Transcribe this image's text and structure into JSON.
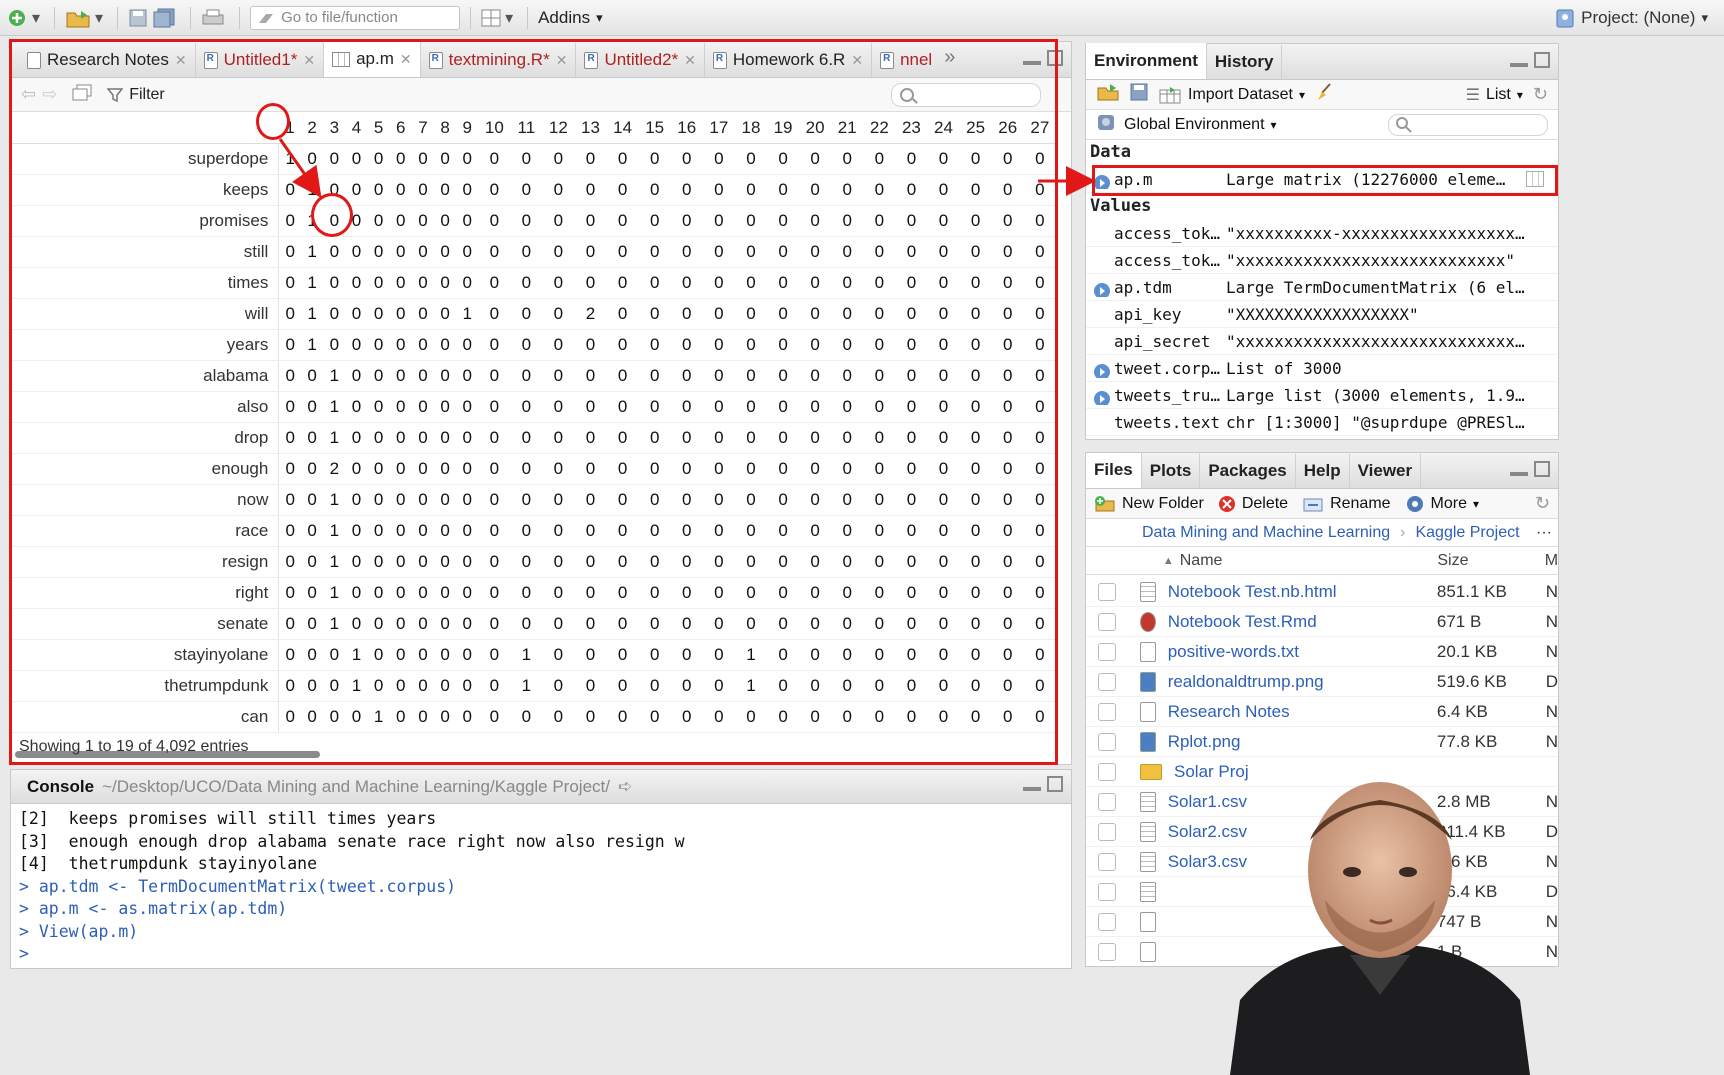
{
  "toolbar": {
    "goto_placeholder": "Go to file/function",
    "addins_label": "Addins",
    "project_label": "Project: (None)"
  },
  "source_tabs": [
    {
      "label": "Research Notes",
      "modified": false
    },
    {
      "label": "Untitled1*",
      "modified": true
    },
    {
      "label": "ap.m",
      "modified": false,
      "active": true
    },
    {
      "label": "textmining.R*",
      "modified": true
    },
    {
      "label": "Untitled2*",
      "modified": true
    },
    {
      "label": "Homework 6.R",
      "modified": false
    },
    {
      "label": "nnel",
      "modified": true
    }
  ],
  "viewer": {
    "filter_label": "Filter",
    "status": "Showing 1 to 19 of 4,092 entries",
    "columns": [
      "1",
      "2",
      "3",
      "4",
      "5",
      "6",
      "7",
      "8",
      "9",
      "10",
      "11",
      "12",
      "13",
      "14",
      "15",
      "16",
      "17",
      "18",
      "19",
      "20",
      "21",
      "22",
      "23",
      "24",
      "25",
      "26",
      "27"
    ],
    "rows": [
      {
        "name": "superdope",
        "values": [
          1,
          0,
          0,
          0,
          0,
          0,
          0,
          0,
          0,
          0,
          0,
          0,
          0,
          0,
          0,
          0,
          0,
          0,
          0,
          0,
          0,
          0,
          0,
          0,
          0,
          0,
          0
        ]
      },
      {
        "name": "keeps",
        "values": [
          0,
          1,
          0,
          0,
          0,
          0,
          0,
          0,
          0,
          0,
          0,
          0,
          0,
          0,
          0,
          0,
          0,
          0,
          0,
          0,
          0,
          0,
          0,
          0,
          0,
          0,
          0
        ]
      },
      {
        "name": "promises",
        "values": [
          0,
          1,
          0,
          0,
          0,
          0,
          0,
          0,
          0,
          0,
          0,
          0,
          0,
          0,
          0,
          0,
          0,
          0,
          0,
          0,
          0,
          0,
          0,
          0,
          0,
          0,
          0
        ]
      },
      {
        "name": "still",
        "values": [
          0,
          1,
          0,
          0,
          0,
          0,
          0,
          0,
          0,
          0,
          0,
          0,
          0,
          0,
          0,
          0,
          0,
          0,
          0,
          0,
          0,
          0,
          0,
          0,
          0,
          0,
          0
        ]
      },
      {
        "name": "times",
        "values": [
          0,
          1,
          0,
          0,
          0,
          0,
          0,
          0,
          0,
          0,
          0,
          0,
          0,
          0,
          0,
          0,
          0,
          0,
          0,
          0,
          0,
          0,
          0,
          0,
          0,
          0,
          0
        ]
      },
      {
        "name": "will",
        "values": [
          0,
          1,
          0,
          0,
          0,
          0,
          0,
          0,
          1,
          0,
          0,
          0,
          2,
          0,
          0,
          0,
          0,
          0,
          0,
          0,
          0,
          0,
          0,
          0,
          0,
          0,
          0
        ]
      },
      {
        "name": "years",
        "values": [
          0,
          1,
          0,
          0,
          0,
          0,
          0,
          0,
          0,
          0,
          0,
          0,
          0,
          0,
          0,
          0,
          0,
          0,
          0,
          0,
          0,
          0,
          0,
          0,
          0,
          0,
          0
        ]
      },
      {
        "name": "alabama",
        "values": [
          0,
          0,
          1,
          0,
          0,
          0,
          0,
          0,
          0,
          0,
          0,
          0,
          0,
          0,
          0,
          0,
          0,
          0,
          0,
          0,
          0,
          0,
          0,
          0,
          0,
          0,
          0
        ]
      },
      {
        "name": "also",
        "values": [
          0,
          0,
          1,
          0,
          0,
          0,
          0,
          0,
          0,
          0,
          0,
          0,
          0,
          0,
          0,
          0,
          0,
          0,
          0,
          0,
          0,
          0,
          0,
          0,
          0,
          0,
          0
        ]
      },
      {
        "name": "drop",
        "values": [
          0,
          0,
          1,
          0,
          0,
          0,
          0,
          0,
          0,
          0,
          0,
          0,
          0,
          0,
          0,
          0,
          0,
          0,
          0,
          0,
          0,
          0,
          0,
          0,
          0,
          0,
          0
        ]
      },
      {
        "name": "enough",
        "values": [
          0,
          0,
          2,
          0,
          0,
          0,
          0,
          0,
          0,
          0,
          0,
          0,
          0,
          0,
          0,
          0,
          0,
          0,
          0,
          0,
          0,
          0,
          0,
          0,
          0,
          0,
          0
        ]
      },
      {
        "name": "now",
        "values": [
          0,
          0,
          1,
          0,
          0,
          0,
          0,
          0,
          0,
          0,
          0,
          0,
          0,
          0,
          0,
          0,
          0,
          0,
          0,
          0,
          0,
          0,
          0,
          0,
          0,
          0,
          0
        ]
      },
      {
        "name": "race",
        "values": [
          0,
          0,
          1,
          0,
          0,
          0,
          0,
          0,
          0,
          0,
          0,
          0,
          0,
          0,
          0,
          0,
          0,
          0,
          0,
          0,
          0,
          0,
          0,
          0,
          0,
          0,
          0
        ]
      },
      {
        "name": "resign",
        "values": [
          0,
          0,
          1,
          0,
          0,
          0,
          0,
          0,
          0,
          0,
          0,
          0,
          0,
          0,
          0,
          0,
          0,
          0,
          0,
          0,
          0,
          0,
          0,
          0,
          0,
          0,
          0
        ]
      },
      {
        "name": "right",
        "values": [
          0,
          0,
          1,
          0,
          0,
          0,
          0,
          0,
          0,
          0,
          0,
          0,
          0,
          0,
          0,
          0,
          0,
          0,
          0,
          0,
          0,
          0,
          0,
          0,
          0,
          0,
          0
        ]
      },
      {
        "name": "senate",
        "values": [
          0,
          0,
          1,
          0,
          0,
          0,
          0,
          0,
          0,
          0,
          0,
          0,
          0,
          0,
          0,
          0,
          0,
          0,
          0,
          0,
          0,
          0,
          0,
          0,
          0,
          0,
          0
        ]
      },
      {
        "name": "stayinyolane",
        "values": [
          0,
          0,
          0,
          1,
          0,
          0,
          0,
          0,
          0,
          0,
          1,
          0,
          0,
          0,
          0,
          0,
          0,
          1,
          0,
          0,
          0,
          0,
          0,
          0,
          0,
          0,
          0
        ]
      },
      {
        "name": "thetrumpdunk",
        "values": [
          0,
          0,
          0,
          1,
          0,
          0,
          0,
          0,
          0,
          0,
          1,
          0,
          0,
          0,
          0,
          0,
          0,
          1,
          0,
          0,
          0,
          0,
          0,
          0,
          0,
          0,
          0
        ]
      },
      {
        "name": "can",
        "values": [
          0,
          0,
          0,
          0,
          1,
          0,
          0,
          0,
          0,
          0,
          0,
          0,
          0,
          0,
          0,
          0,
          0,
          0,
          0,
          0,
          0,
          0,
          0,
          0,
          0,
          0,
          0
        ]
      }
    ]
  },
  "console": {
    "title": "Console",
    "path": "~/Desktop/UCO/Data Mining and Machine Learning/Kaggle Project/",
    "lines": [
      {
        "type": "out",
        "text": "[2]  keeps promises will still times years"
      },
      {
        "type": "out",
        "text": "[3]  enough enough drop alabama senate race right now also resign w"
      },
      {
        "type": "out",
        "text": "[4]  thetrumpdunk stayinyolane"
      },
      {
        "type": "in",
        "text": "> ap.tdm <- TermDocumentMatrix(tweet.corpus)"
      },
      {
        "type": "in",
        "text": "> ap.m <- as.matrix(ap.tdm)"
      },
      {
        "type": "in",
        "text": "> View(ap.m)"
      },
      {
        "type": "in",
        "text": "> "
      }
    ]
  },
  "environment": {
    "tabs": [
      "Environment",
      "History"
    ],
    "import_label": "Import Dataset",
    "list_label": "List",
    "scope_label": "Global Environment",
    "data_header": "Data",
    "values_header": "Values",
    "data": [
      {
        "name": "ap.m",
        "value": "Large matrix (12276000 eleme…",
        "expand": true
      }
    ],
    "values": [
      {
        "name": "access_token",
        "value": "\"xxxxxxxxxx-xxxxxxxxxxxxxxxxxx…",
        "expand": false
      },
      {
        "name": "access_toke…",
        "value": "\"xxxxxxxxxxxxxxxxxxxxxxxxxxxx\"",
        "expand": false
      },
      {
        "name": "ap.tdm",
        "value": "Large TermDocumentMatrix (6 el…",
        "expand": true
      },
      {
        "name": "api_key",
        "value": "\"XXXXXXXXXXXXXXXXXX\"",
        "expand": false
      },
      {
        "name": "api_secret",
        "value": "\"xxxxxxxxxxxxxxxxxxxxxxxxxxxxx…",
        "expand": false
      },
      {
        "name": "tweet.corpus",
        "value": "List of 3000",
        "expand": true
      },
      {
        "name": "tweets_trump",
        "value": "Large list (3000 elements, 1.9…",
        "expand": true
      },
      {
        "name": "tweets.text",
        "value": "chr [1:3000] \"@suprdupe @PRESl…",
        "expand": false
      }
    ]
  },
  "files": {
    "tabs": [
      "Files",
      "Plots",
      "Packages",
      "Help",
      "Viewer"
    ],
    "new_folder_label": "New Folder",
    "delete_label": "Delete",
    "rename_label": "Rename",
    "more_label": "More",
    "breadcrumb": [
      "Data Mining and Machine Learning",
      "Kaggle Project"
    ],
    "name_header": "Name",
    "size_header": "Size",
    "modified_header": "M",
    "rows": [
      {
        "name": "Notebook Test.nb.html",
        "size": "851.1 KB",
        "icon": "html",
        "m": "N"
      },
      {
        "name": "Notebook Test.Rmd",
        "size": "671 B",
        "icon": "rmd",
        "m": "N"
      },
      {
        "name": "positive-words.txt",
        "size": "20.1 KB",
        "icon": "txt",
        "m": "N"
      },
      {
        "name": "realdonaldtrump.png",
        "size": "519.6 KB",
        "icon": "img",
        "m": "D"
      },
      {
        "name": "Research Notes",
        "size": "6.4 KB",
        "icon": "txt",
        "m": "N"
      },
      {
        "name": "Rplot.png",
        "size": "77.8 KB",
        "icon": "img",
        "m": "N"
      },
      {
        "name": "Solar Proj",
        "size": "",
        "icon": "folder",
        "m": ""
      },
      {
        "name": "Solar1.csv",
        "size": "2.8 MB",
        "icon": "csv",
        "m": "N"
      },
      {
        "name": "Solar2.csv",
        "size": "211.4 KB",
        "icon": "csv",
        "m": "D"
      },
      {
        "name": "Solar3.csv",
        "size": "1.6 KB",
        "icon": "csv",
        "m": "N"
      },
      {
        "name": "",
        "size": "36.4 KB",
        "icon": "csv",
        "m": "D"
      },
      {
        "name": "",
        "size": "747 B",
        "icon": "txt",
        "m": "N"
      },
      {
        "name": "",
        "size": "1 B",
        "icon": "txt",
        "m": "N"
      }
    ]
  },
  "colors": {
    "annotation": "#e01818",
    "link": "#2d5fb8",
    "modified_tab": "#b02222"
  }
}
